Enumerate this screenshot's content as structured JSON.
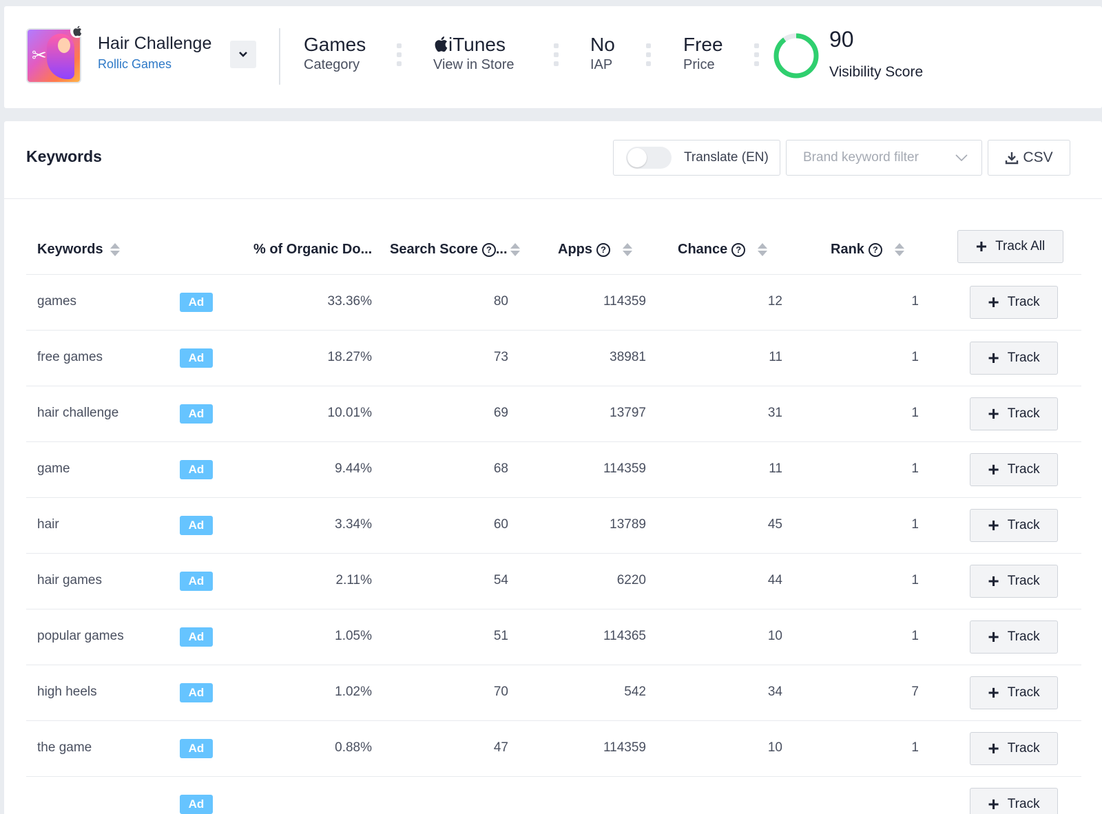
{
  "app": {
    "title": "Hair Challenge",
    "developer": "Rollic Games",
    "icon": "app-icon",
    "platform_icon": "apple-icon"
  },
  "stats": {
    "category_value": "Games",
    "category_label": "Category",
    "store_value": "iTunes",
    "store_label": "View in Store",
    "iap_value": "No",
    "iap_label": "IAP",
    "price_value": "Free",
    "price_label": "Price",
    "visibility_score": "90",
    "visibility_label": "Visibility Score",
    "visibility_fraction": 0.9,
    "visibility_color": "#2fcf6e"
  },
  "keywords_section": {
    "heading": "Keywords",
    "translate_label": "Translate (EN)",
    "brand_filter_placeholder": "Brand keyword filter",
    "csv_label": "CSV"
  },
  "table": {
    "columns": {
      "keywords": "Keywords",
      "organic": "% of Organic Do...",
      "search_score": "Search Score",
      "search_score_suffix": "...",
      "apps": "Apps",
      "chance": "Chance",
      "rank": "Rank"
    },
    "track_all_label": "Track All",
    "track_label": "Track",
    "ad_badge": "Ad",
    "ad_color": "#66c4ff",
    "rows": [
      {
        "keyword": "games",
        "organic": "33.36%",
        "score": "80",
        "apps": "114359",
        "chance": "12",
        "rank": "1"
      },
      {
        "keyword": "free games",
        "organic": "18.27%",
        "score": "73",
        "apps": "38981",
        "chance": "11",
        "rank": "1"
      },
      {
        "keyword": "hair challenge",
        "organic": "10.01%",
        "score": "69",
        "apps": "13797",
        "chance": "31",
        "rank": "1"
      },
      {
        "keyword": "game",
        "organic": "9.44%",
        "score": "68",
        "apps": "114359",
        "chance": "11",
        "rank": "1"
      },
      {
        "keyword": "hair",
        "organic": "3.34%",
        "score": "60",
        "apps": "13789",
        "chance": "45",
        "rank": "1"
      },
      {
        "keyword": "hair games",
        "organic": "2.11%",
        "score": "54",
        "apps": "6220",
        "chance": "44",
        "rank": "1"
      },
      {
        "keyword": "popular games",
        "organic": "1.05%",
        "score": "51",
        "apps": "114365",
        "chance": "10",
        "rank": "1"
      },
      {
        "keyword": "high heels",
        "organic": "1.02%",
        "score": "70",
        "apps": "542",
        "chance": "34",
        "rank": "7"
      },
      {
        "keyword": "the game",
        "organic": "0.88%",
        "score": "47",
        "apps": "114359",
        "chance": "10",
        "rank": "1"
      },
      {
        "keyword": "",
        "organic": "",
        "score": "",
        "apps": "",
        "chance": "",
        "rank": ""
      }
    ]
  }
}
